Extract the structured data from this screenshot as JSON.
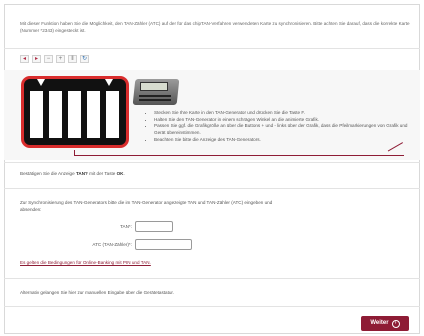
{
  "intro": {
    "text": "Mit dieser Funktion haben Sie die Möglichkeit, den TAN-Zähler (ATC) auf der für das chipTAN-Verfahren verwendeten Karte zu synchronisieren. Bitte achten Sie darauf, dass die korrekte Karte (Nummer *2343) eingesteckt ist."
  },
  "toolbar": {
    "buttons": [
      {
        "icon": "zoom-out-icon",
        "glyph": "◂"
      },
      {
        "icon": "zoom-in-icon",
        "glyph": "▸"
      },
      {
        "icon": "reduce-speed-icon",
        "glyph": "−"
      },
      {
        "icon": "increase-speed-icon",
        "glyph": "+"
      },
      {
        "icon": "pause-icon",
        "glyph": "‖"
      },
      {
        "icon": "refresh-icon",
        "glyph": "↻"
      }
    ]
  },
  "instructions": {
    "bullets": [
      "Stecken Sie Ihre Karte in den TAN-Generator und drücken Sie die Taste F.",
      "Halten Sie den TAN-Generator in einem schrägen Winkel an die animierte Grafik.",
      "Passen Sie ggf. die Grafikgröße an über die Buttons + und - links über der Grafik, dass die Pfeilmarkierungen von Grafik und Gerät übereinstimmen.",
      "Beachten Sie bitte die Anzeige des TAN-Generators."
    ]
  },
  "confirm": {
    "prefix": "Bestätigen Sie die Anzeige ",
    "bold1": "TAN?",
    "middle": " mit der Taste ",
    "bold2": "OK",
    "suffix": "."
  },
  "sync": {
    "text": "Zur Synchronisierung des TAN-Generators bitte die im TAN-Generator angezeigte TAN und TAN-Zähler (ATC) eingeben und absenden:",
    "tan_label": "TAN*:",
    "tan_value": "",
    "atc_label": "ATC (TAN-Zähler)*:",
    "atc_value": ""
  },
  "terms_link": "Es gelten die Bedingungen für Online-Banking mit PIN und TAN.",
  "alt_text": "Alternativ gelangen Sie hier zur manuellen Eingabe über die Gerätetastatur.",
  "next_button": {
    "label": "Weiter",
    "icon": "arrow-right-circle-icon",
    "glyph": "›"
  },
  "colors": {
    "accent": "#8e1c35",
    "frame_border": "#d92d2d"
  }
}
